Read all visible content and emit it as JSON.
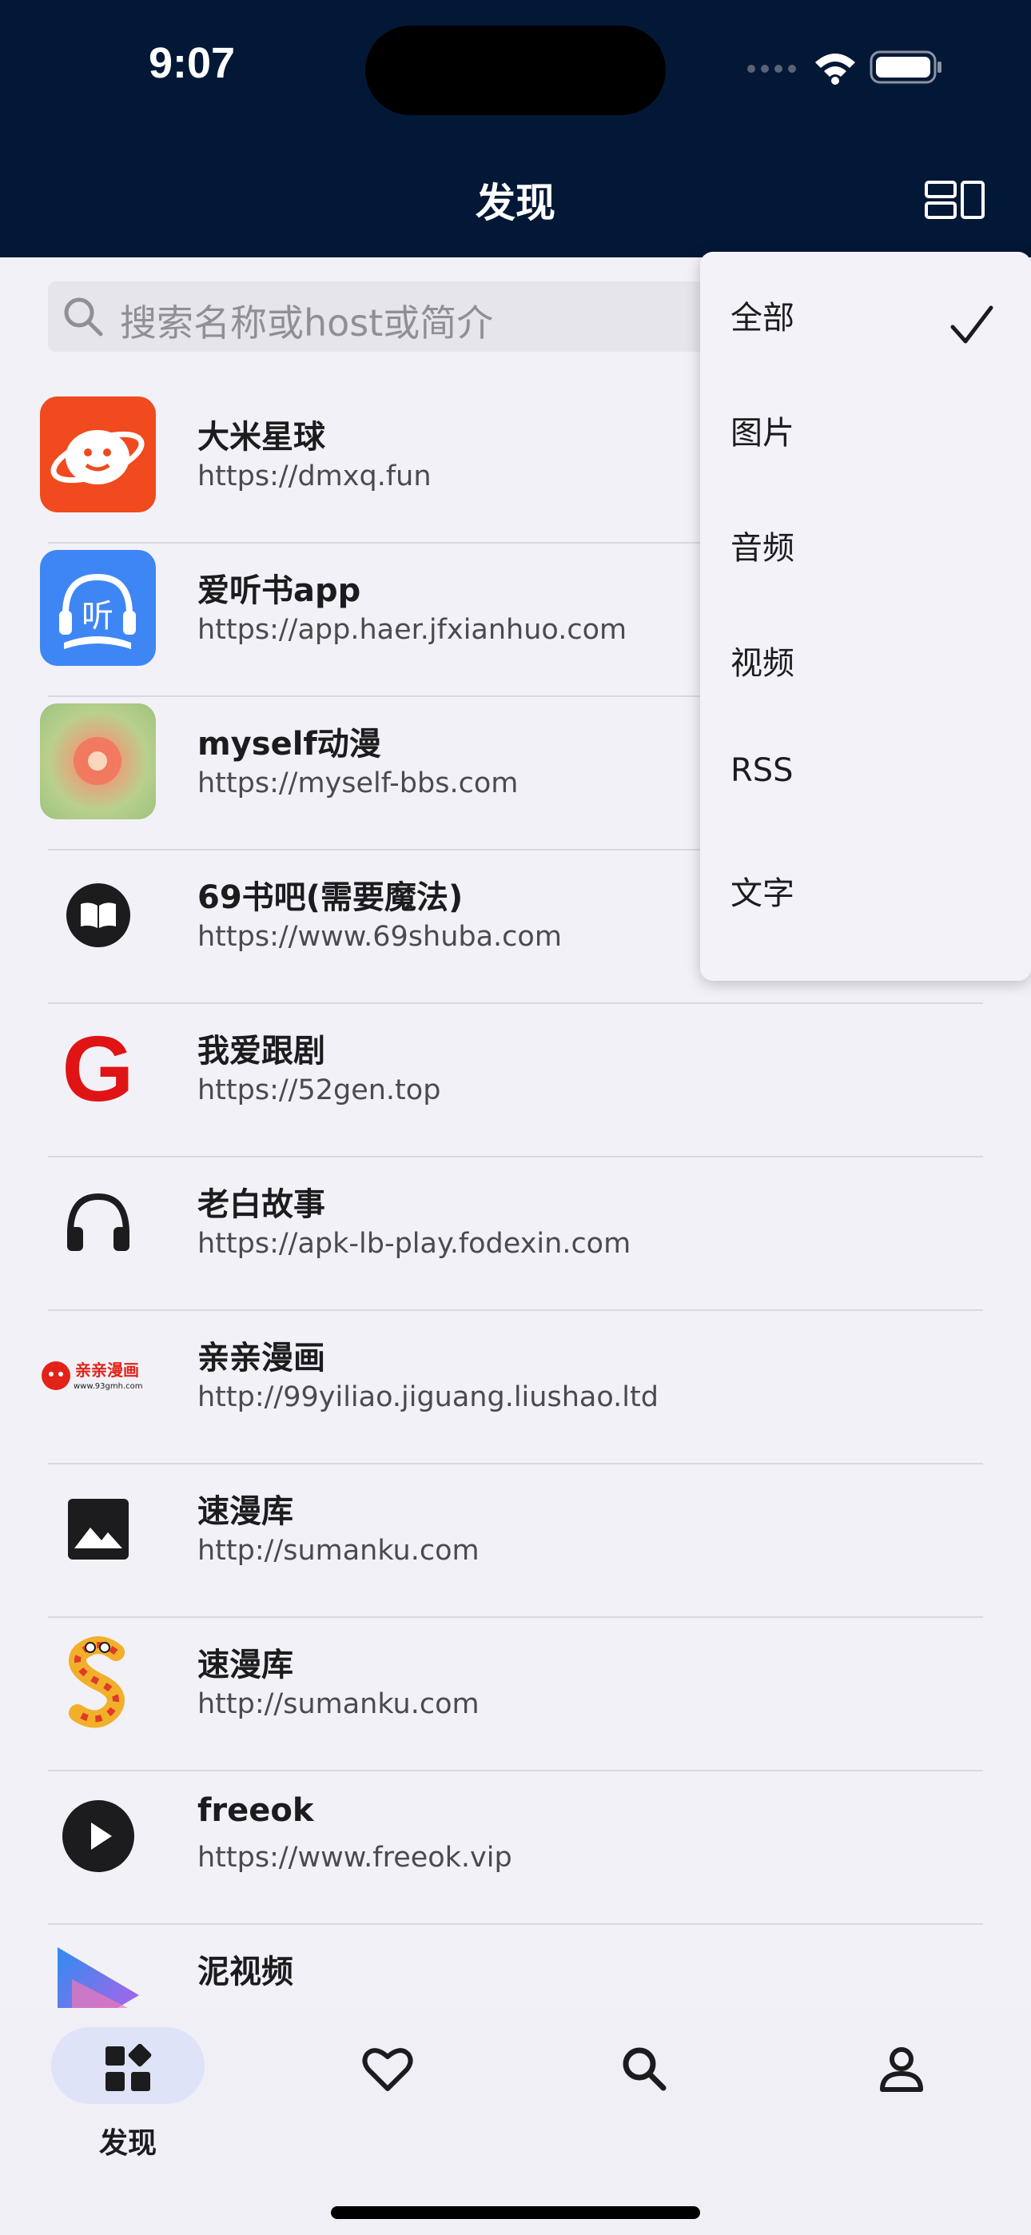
{
  "status_bar": {
    "time": "9:07"
  },
  "header": {
    "title": "发现",
    "layout_icon": "layout-toggle-icon"
  },
  "search": {
    "placeholder": "搜索名称或host或简介"
  },
  "sources": [
    {
      "name": "大米星球",
      "url": "https://dmxq.fun",
      "icon": "rice-planet-logo"
    },
    {
      "name": "爱听书app",
      "url": "https://app.haer.jfxianhuo.com",
      "icon": "ting-book-logo"
    },
    {
      "name": "myself动漫",
      "url": "https://myself-bbs.com",
      "icon": "blurred-flower-logo"
    },
    {
      "name": "69书吧(需要魔法)",
      "url": "https://www.69shuba.com",
      "icon": "book-icon"
    },
    {
      "name": "我爱跟剧",
      "url": "https://52gen.top",
      "icon": "g-letter-logo"
    },
    {
      "name": "老白故事",
      "url": "https://apk-lb-play.fodexin.com",
      "icon": "headphones-icon"
    },
    {
      "name": "亲亲漫画",
      "url": "http://99yiliao.jiguang.liushao.ltd",
      "icon": "qinqin-manhua-logo"
    },
    {
      "name": "速漫库",
      "url": "http://sumanku.com",
      "icon": "image-icon"
    },
    {
      "name": "速漫库",
      "url": "http://sumanku.com",
      "icon": "dollar-character-logo"
    },
    {
      "name": "freeok",
      "url": "https://www.freeok.vip",
      "icon": "play-circle-icon"
    },
    {
      "name": "泥视频",
      "url": "",
      "icon": "ni-video-logo"
    }
  ],
  "qinqin_logo_text": {
    "main": "亲亲漫画",
    "sub": "www.93gmh.com"
  },
  "ting_logo_text": "听",
  "g_logo_text": "G",
  "filter_menu": {
    "items": [
      {
        "label": "全部",
        "selected": true
      },
      {
        "label": "图片",
        "selected": false
      },
      {
        "label": "音频",
        "selected": false
      },
      {
        "label": "视频",
        "selected": false
      },
      {
        "label": "RSS",
        "selected": false
      },
      {
        "label": "文字",
        "selected": false
      }
    ]
  },
  "tabbar": {
    "tabs": [
      {
        "label": "发现",
        "icon": "discover-icon",
        "active": true
      },
      {
        "label": "",
        "icon": "heart-icon",
        "active": false
      },
      {
        "label": "",
        "icon": "search-icon",
        "active": false
      },
      {
        "label": "",
        "icon": "person-icon",
        "active": false
      }
    ]
  },
  "colors": {
    "header_bg": "#031836",
    "page_bg": "#f2f1f7",
    "active_tab_pill": "#dfe3f7"
  }
}
